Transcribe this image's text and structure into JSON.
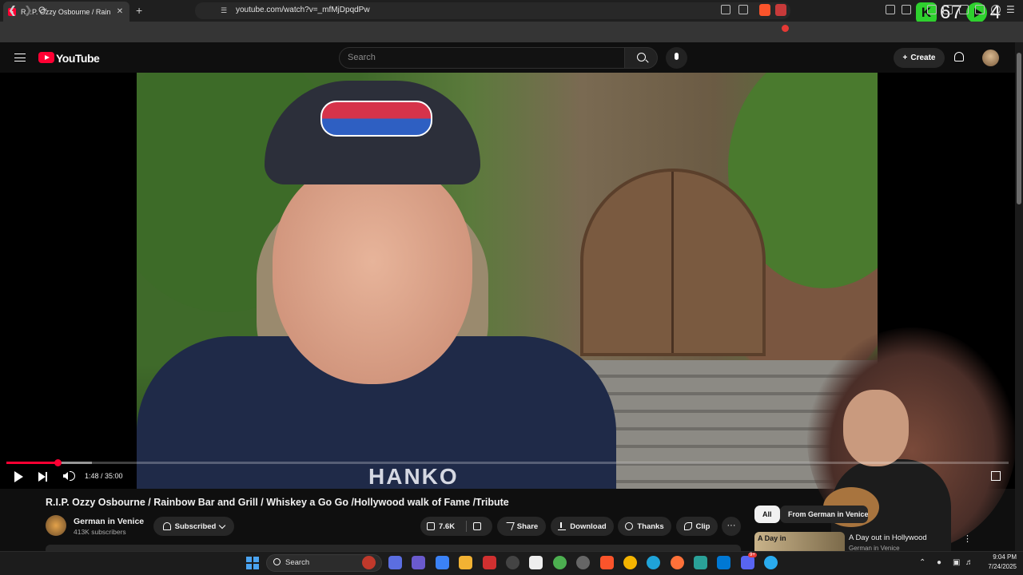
{
  "browser": {
    "tab_title": "R.I.P. Ozzy Osbourne / Rainbow",
    "tab_close": "✕",
    "new_tab": "+",
    "url": "youtube.com/watch?v=_mfMjDpqdPw",
    "overlay": {
      "badge_letter": "K",
      "count_left": "67",
      "count_right": "4"
    }
  },
  "youtube": {
    "wordmark": "YouTube",
    "search_placeholder": "Search",
    "create_label": "Create",
    "create_plus": "+"
  },
  "player": {
    "time": "1:48 / 35:00",
    "progress_fraction": 0.0514,
    "buffered_fraction": 0.085
  },
  "video": {
    "title": "R.I.P. Ozzy Osbourne / Rainbow Bar and Grill / Whiskey a Go Go /Hollywood walk of Fame /Tribute",
    "shirt_text": "HANKO"
  },
  "channel": {
    "name": "German in Venice",
    "subscribers": "413K subscribers",
    "subscribed_label": "Subscribed"
  },
  "actions": {
    "likes": "7.6K",
    "share": "Share",
    "download": "Download",
    "thanks": "Thanks",
    "clip": "Clip",
    "more": "···"
  },
  "related": {
    "chip_all": "All",
    "chip_from": "From German in Venice",
    "item_thumb_text": "A Day in",
    "item_title": "A Day out in Hollywood",
    "item_channel": "German in Venice",
    "item_menu": "⋮"
  },
  "taskbar": {
    "search_label": "Search",
    "time": "9:04 PM",
    "date": "7/24/2025",
    "notif_count": "9+"
  },
  "colors": {
    "brand_red": "#ff0033",
    "accent_green": "#2ed12e",
    "bg": "#0f0f0f"
  }
}
